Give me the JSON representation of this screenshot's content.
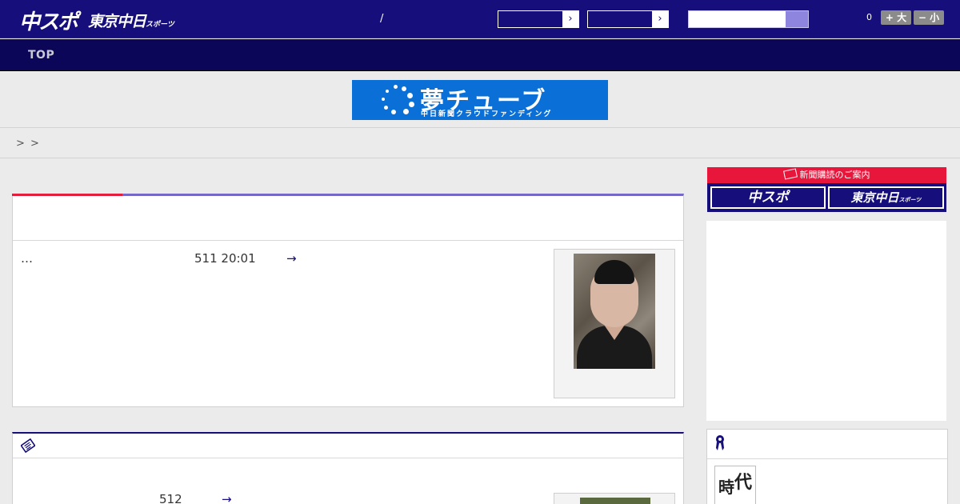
{
  "header": {
    "logo_primary": "中スポ",
    "logo_secondary": "東京中日",
    "logo_secondary_small": "スポーツ",
    "separator": "/",
    "select_arrow_1": "›",
    "select_arrow_2": "›",
    "search_placeholder": "",
    "font_size_count": "0",
    "font_larger_label": "+ 大",
    "font_smaller_label": "− 小"
  },
  "nav": {
    "top_label": "TOP"
  },
  "banner": {
    "title": "夢チューブ",
    "subtitle": "中日新聞クラウドファンディング"
  },
  "breadcrumb": {
    "sep1": ">",
    "sep2": ">"
  },
  "article": {
    "excerpt": "…",
    "date": "511 20:01",
    "arrow": "→"
  },
  "article2": {
    "date": "512",
    "arrow": "→"
  },
  "sidebar": {
    "subscribe_label": "新聞購読のご案内",
    "chuspo_label": "中スポ",
    "tokyo_label": "東京中日",
    "tokyo_small": "スポーツ",
    "book_char_1": "時",
    "book_char_2": "代"
  },
  "colors": {
    "header_bg": "#160e7a",
    "nav_bg": "#0c0658",
    "accent_red": "#e11e3c",
    "banner_blue": "#0a6fd6"
  }
}
